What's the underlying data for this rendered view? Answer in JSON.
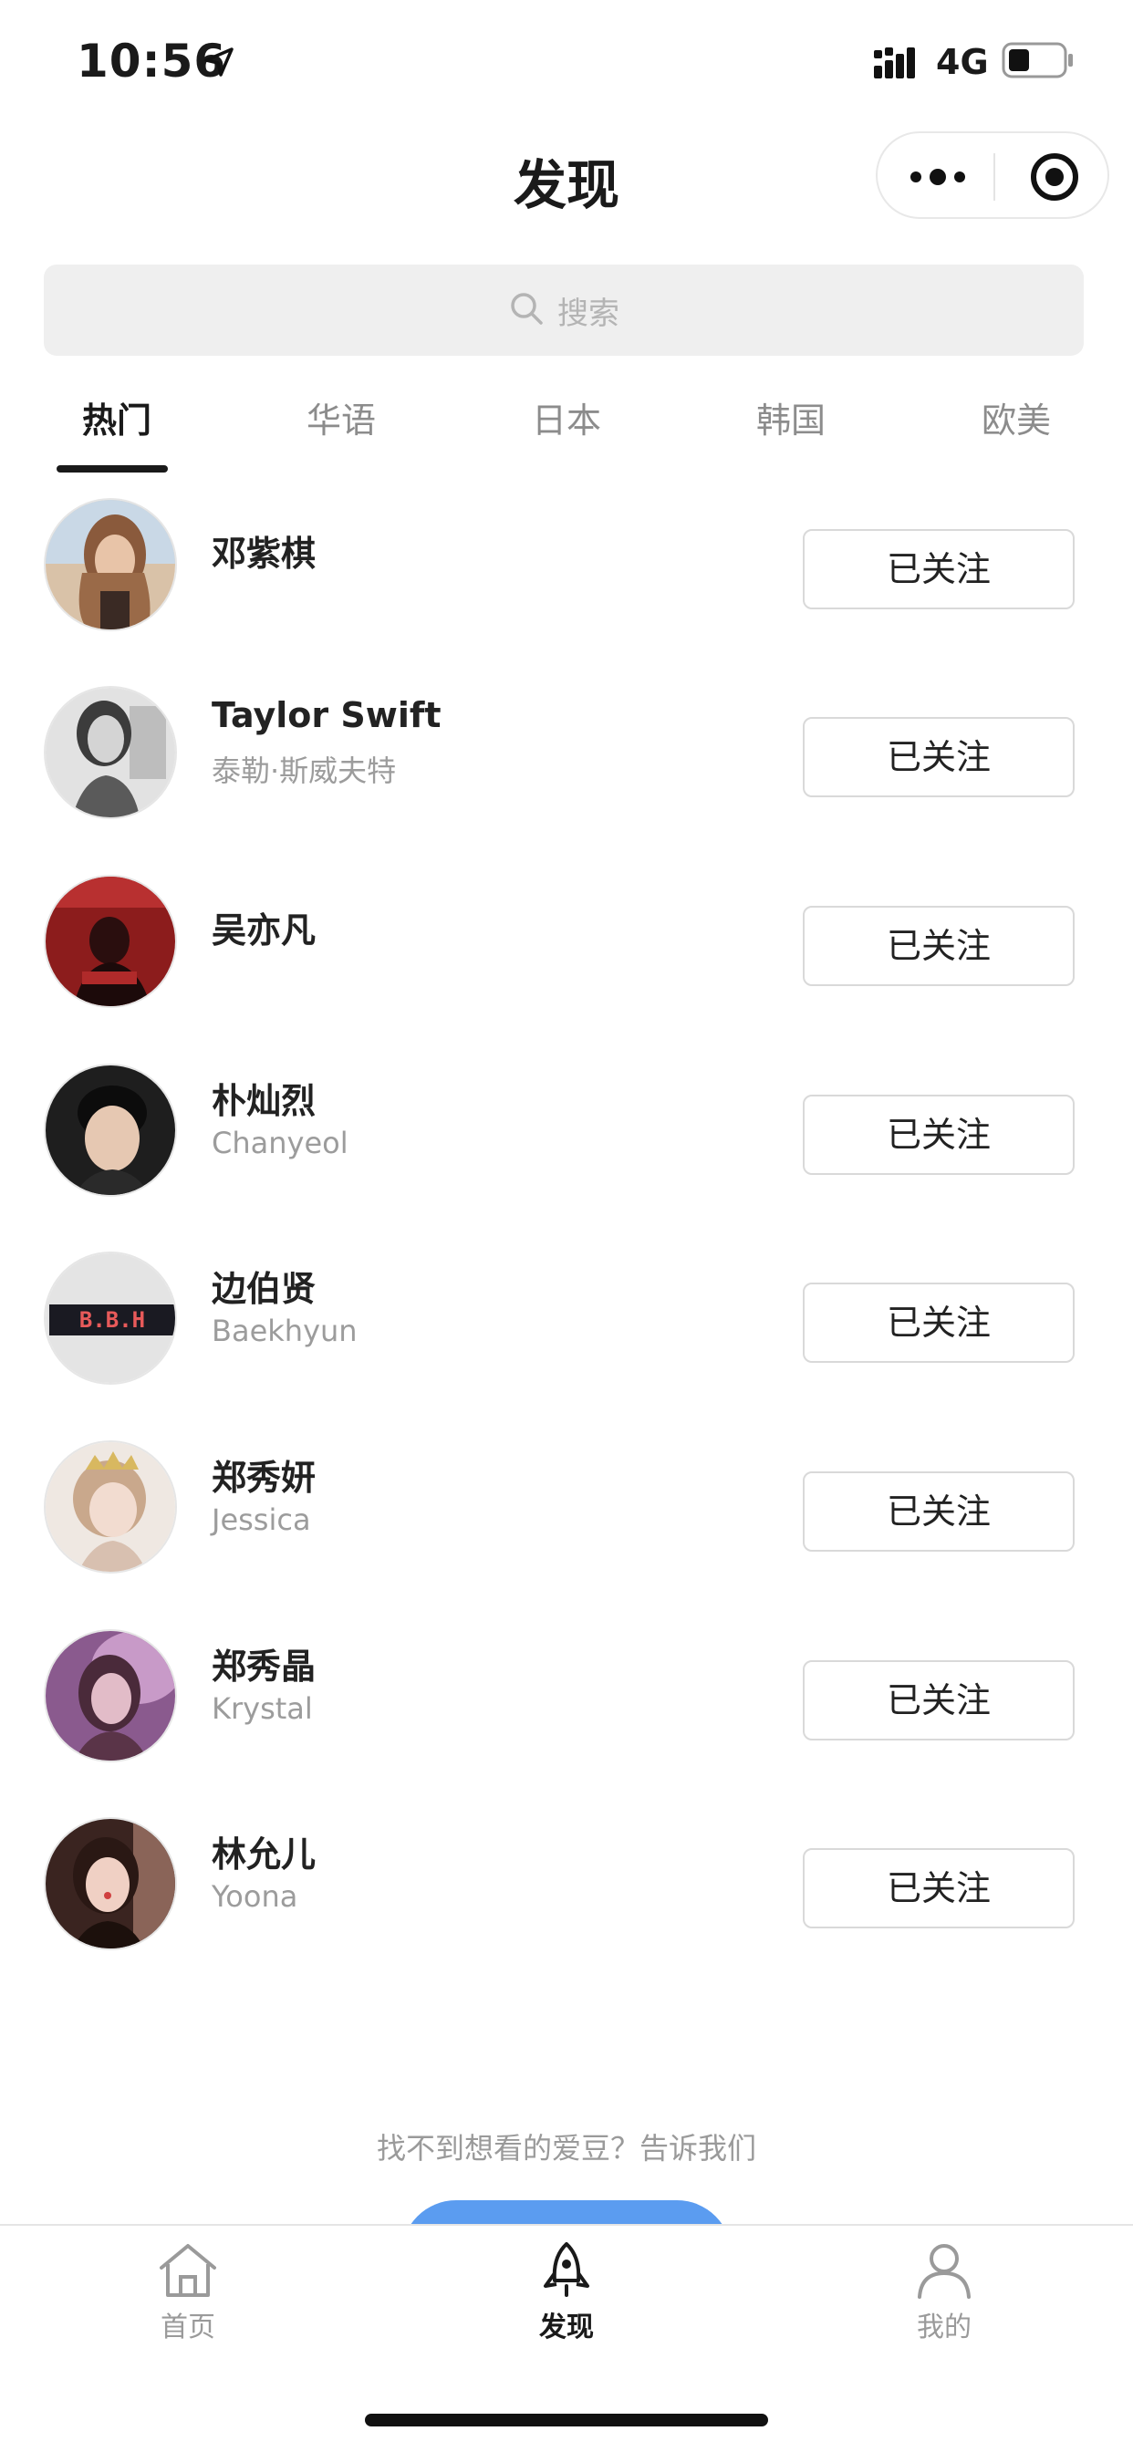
{
  "status_bar": {
    "time": "10:56",
    "network": "4G",
    "icons": [
      "location-arrow-icon",
      "signal-icon",
      "battery-icon"
    ]
  },
  "nav": {
    "title": "发现",
    "capsule_icons": [
      "more-icon",
      "close-target-icon"
    ]
  },
  "search": {
    "placeholder": "搜索",
    "icon": "search-icon"
  },
  "tabs": [
    {
      "label": "热门",
      "active": true
    },
    {
      "label": "华语",
      "active": false
    },
    {
      "label": "日本",
      "active": false
    },
    {
      "label": "韩国",
      "active": false
    },
    {
      "label": "欧美",
      "active": false
    }
  ],
  "artists": [
    {
      "name": "邓紫棋",
      "sub": "",
      "button": "已关注"
    },
    {
      "name": "Taylor Swift",
      "sub": "泰勒·斯威夫特",
      "button": "已关注"
    },
    {
      "name": "吴亦凡",
      "sub": "",
      "button": "已关注"
    },
    {
      "name": "朴灿烈",
      "sub": "Chanyeol",
      "button": "已关注"
    },
    {
      "name": "边伯贤",
      "sub": "Baekhyun",
      "button": "已关注",
      "avatar_text": "B.B.H"
    },
    {
      "name": "郑秀妍",
      "sub": "Jessica",
      "button": "已关注"
    },
    {
      "name": "郑秀晶",
      "sub": "Krystal",
      "button": "已关注"
    },
    {
      "name": "林允儿",
      "sub": "Yoona",
      "button": "已关注"
    }
  ],
  "footer": {
    "prompt": "找不到想看的爱豆？告诉我们"
  },
  "tab_bar": [
    {
      "label": "首页",
      "icon": "home-icon",
      "active": false
    },
    {
      "label": "发现",
      "icon": "rocket-icon",
      "active": true
    },
    {
      "label": "我的",
      "icon": "person-icon",
      "active": false
    }
  ],
  "colors": {
    "accent": "#5b9cf0",
    "text": "#1a1a1a",
    "muted": "#9a9a9a",
    "search_bg": "#efefef"
  }
}
